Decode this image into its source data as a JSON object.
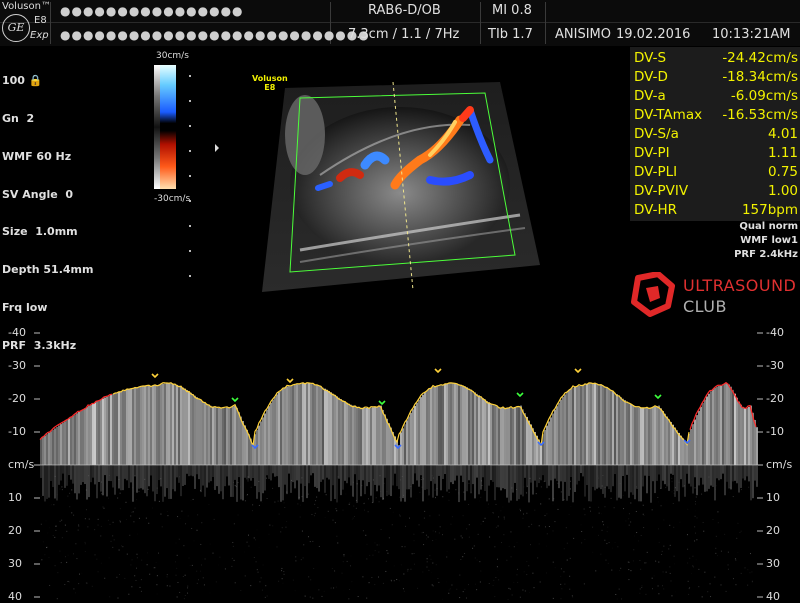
{
  "header": {
    "brand": "Voluson",
    "brand_trademark": "™",
    "model": "E8",
    "exp": "Exp",
    "patient_name_masked": "●●●●●●●●●●●●●●●●",
    "patient_id_masked": "●●●●●●●●●●●●●●●●●●●●●●●●●●●",
    "probe_preset": "RAB6-D/OB",
    "mi": "MI  0.8",
    "depth_freq": "7.3cm / 1.1 /  7Hz",
    "tib": "TIb  1.7",
    "operator": "ANISIMO",
    "date": "19.02.2016",
    "time": "10:13:21AM"
  },
  "left_params": [
    "100",
    "Gn  2",
    "WMF 60 Hz",
    "SV Angle  0",
    "Size  1.0mm",
    "Depth 51.4mm",
    "Frq low",
    "PRF  3.3kHz"
  ],
  "color_scale": {
    "top": "30cm/s",
    "bottom": "-30cm/s"
  },
  "image_logo": {
    "line1": "Voluson",
    "line2": "E8"
  },
  "measurements": [
    {
      "key": "DV-S",
      "value": "-24.42cm/s"
    },
    {
      "key": "DV-D",
      "value": "-18.34cm/s"
    },
    {
      "key": "DV-a",
      "value": "-6.09cm/s"
    },
    {
      "key": "DV-TAmax",
      "value": "-16.53cm/s"
    },
    {
      "key": "DV-S/a",
      "value": "4.01"
    },
    {
      "key": "DV-PI",
      "value": "1.11"
    },
    {
      "key": "DV-PLI",
      "value": "0.75"
    },
    {
      "key": "DV-PVIV",
      "value": "1.00"
    },
    {
      "key": "DV-HR",
      "value": "157bpm"
    }
  ],
  "extra_params": [
    "Qual norm",
    "WMF low1",
    "PRF  2.4kHz"
  ],
  "watermark": {
    "line1": "ULTRASOUND",
    "line2": "CLUB"
  },
  "doppler_axis": {
    "unit": "cm/s",
    "left_labels": [
      "-40",
      "-30",
      "-20",
      "-10",
      "cm/s",
      "10",
      "20",
      "30",
      "40"
    ],
    "right_labels": [
      "-40",
      "-30",
      "-20",
      "-10",
      "cm/s",
      "10",
      "20",
      "30",
      "40"
    ]
  },
  "colors": {
    "measure_text": "#f2f200",
    "trace_yellow": "#ffd23a",
    "trace_red": "#ff2a2a",
    "background": "#000000"
  }
}
